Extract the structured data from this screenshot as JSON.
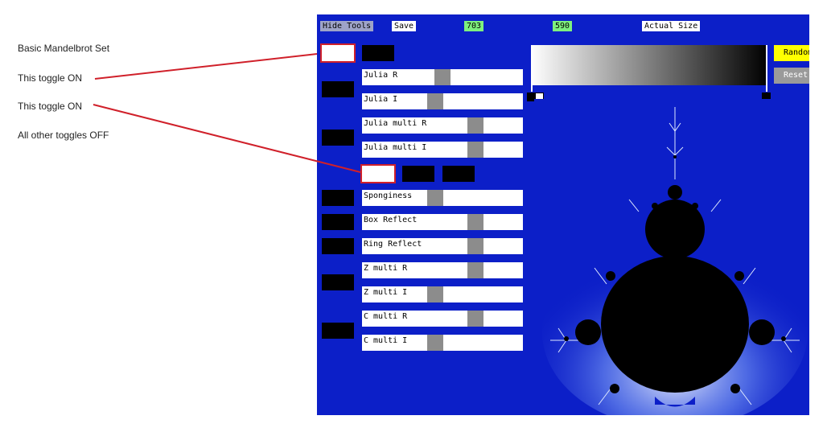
{
  "annotations": [
    {
      "text": "Basic Mandelbrot Set"
    },
    {
      "text": "This toggle ON"
    },
    {
      "text": "This toggle ON"
    },
    {
      "text": "All other toggles OFF"
    }
  ],
  "toolbar": {
    "hide_tools": "Hide Tools",
    "save": "Save",
    "width": "703",
    "height": "590",
    "actual_size": "Actual Size"
  },
  "toggles": [
    {
      "state": "on"
    },
    {
      "state": "off"
    },
    {
      "state": "off"
    },
    {
      "state": "off"
    },
    {
      "state": "on"
    },
    {
      "state": "off"
    },
    {
      "state": "off"
    },
    {
      "state": "off"
    },
    {
      "state": "off"
    },
    {
      "state": "off"
    },
    {
      "state": "off"
    },
    {
      "state": "off"
    }
  ],
  "sliders": [
    {
      "label": "Julia R",
      "value": 0.5
    },
    {
      "label": "Julia I",
      "value": 0.45
    },
    {
      "label": "Julia multi R",
      "value": 0.73
    },
    {
      "label": "Julia multi I",
      "value": 0.73
    },
    {
      "label": "Sponginess",
      "value": 0.45
    },
    {
      "label": "Box Reflect",
      "value": 0.73
    },
    {
      "label": "Ring Reflect",
      "value": 0.73
    },
    {
      "label": "Z multi R",
      "value": 0.73
    },
    {
      "label": "Z multi I",
      "value": 0.45
    },
    {
      "label": "C multi R",
      "value": 0.73
    },
    {
      "label": "C multi I",
      "value": 0.45
    }
  ],
  "palette": {
    "start_color": "#ffffff",
    "end_color": "#000000",
    "buttons": {
      "random": "Random",
      "reset": "Reset"
    }
  },
  "colors": {
    "background": "#0c1fc8",
    "highlight": "#d0202a",
    "random_button": "#ffff00",
    "dimension_badge": "#7ef07e"
  }
}
